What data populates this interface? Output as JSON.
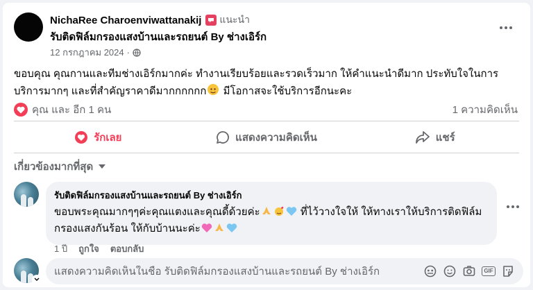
{
  "post": {
    "author": "NichaRee Charoenviwattanakij",
    "recommend_label": "แนะนำ",
    "page_name": "รับติดฟิล์มกรองแสงบ้านและรถยนต์ By ช่างเอิร์ก",
    "date": "12 กรกฎาคม 2024",
    "separator": "·",
    "text_main": "ขอบคุณ คุณกานและทีมช่างเอิร์กมากค่ะ ทำงานเรียบร้อยและรวดเร็วมาก ให้คำแนะนำดีมาก ประทับใจในการบริการมากๆ และที่สำคัญราคาดีมากกกกกก",
    "text_tail": " มีโอกาสจะใช้บริการอีกนะคะ"
  },
  "reactions": {
    "summary": "คุณ และ อีก 1 คน",
    "comment_count": "1 ความคิดเห็น"
  },
  "actions": {
    "like": "รักเลย",
    "comment": "แสดงความคิดเห็น",
    "share": "แชร์"
  },
  "sort": {
    "label": "เกี่ยวข้องมากที่สุด"
  },
  "comment": {
    "author": "รับติดฟิล์มกรองแสงบ้านและรถยนต์ By ช่างเอิร์ก",
    "text_part1": "ขอบพระคุณมากๆๆค่ะคุณแตงและคุณดี้ด้วยค่ะ",
    "text_part2": " ที่ไว้วางใจให้ ให้ทางเราให้บริการติดฟิล์มกรองแสงกันร้อน ให้กับบ้านนะค่ะ",
    "time": "1 ปี",
    "like": "ถูกใจ",
    "reply": "ตอบกลับ"
  },
  "reply_box": {
    "placeholder": "แสดงความคิดเห็นในชื่อ รับติดฟิล์มกรองแสงบ้านและรถยนต์ By ช่างเอิร์ก"
  },
  "icons": {
    "badge": "recommend-badge-icon",
    "privacy": "globe-icon",
    "reaction": "heart-icon",
    "like": "heart-outline-icon",
    "comment": "speech-bubble-icon",
    "share": "share-arrow-icon",
    "sort": "chevron-down-icon",
    "avatar": "avatar-icon",
    "emoji": "emoji-icon",
    "camera": "camera-icon",
    "gif": "gif-icon",
    "sticker": "sticker-icon"
  },
  "colors": {
    "accent_love": "#f33e58",
    "text_secondary": "#65676b",
    "bubble_bg": "#f0f2f5"
  }
}
